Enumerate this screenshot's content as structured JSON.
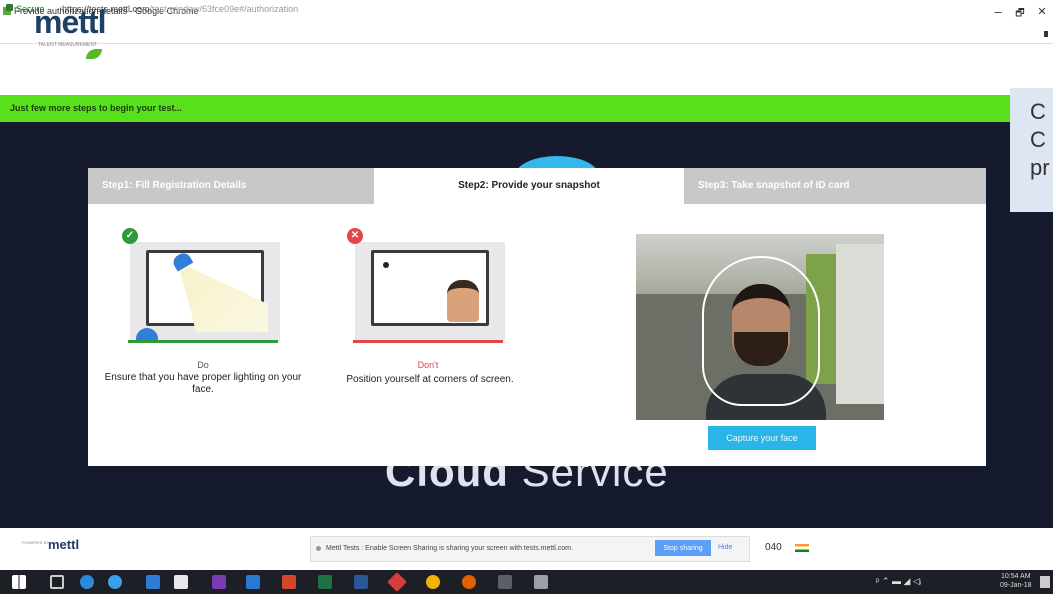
{
  "browser": {
    "window_title": "Provide authorization details - Google Chrome",
    "secure_label": "Secure",
    "url_host": "https://tests.mettl.com",
    "url_path": "/test-window/63fce09e#/authorization",
    "win_minimize": "–",
    "win_maximize": "🗗",
    "win_close": "✕"
  },
  "site": {
    "logo": "mettl",
    "logo_tagline": "TALENT MEASUREMENT",
    "banner": "Just few more steps to begin your test..."
  },
  "side_card": {
    "lines": [
      "C",
      "C",
      "pr"
    ]
  },
  "background": {
    "cloud_bold": "Cloud",
    "cloud_light": " Service"
  },
  "steps": {
    "step1": "Step1: Fill Registration Details",
    "step2": "Step2: Provide your snapshot",
    "step3": "Step3: Take snapshot of ID card"
  },
  "guide": {
    "do_label": "Do",
    "do_text": "Ensure that you have proper lighting on your face.",
    "dont_label": "Don't",
    "dont_text": "Position yourself at corners of screen."
  },
  "capture_button": "Capture your face",
  "footer": {
    "powered_by": "POWERED BY",
    "logo": "mettl",
    "share_text": "Mettl Tests : Enable Screen Sharing is sharing your screen with tests.mettl.com.",
    "stop_sharing": "Stop sharing",
    "hide": "Hide",
    "number": "040"
  },
  "taskbar": {
    "time": "10:54 AM",
    "date": "09-Jan-18"
  },
  "colors": {
    "accent_green": "#58e01c",
    "dark_bg": "#151a2d",
    "capture_blue": "#29b5e8",
    "do_green": "#2e9b3a",
    "dont_red": "#e04848"
  },
  "icons": [
    "windows-start-icon",
    "task-view-icon",
    "edge-icon",
    "ie-icon",
    "store-icon",
    "onenote-icon",
    "outlook-icon",
    "powerpoint-icon",
    "excel-icon",
    "word-icon",
    "chrome-icon",
    "firefox-icon",
    "media-icon",
    "pen-icon"
  ]
}
